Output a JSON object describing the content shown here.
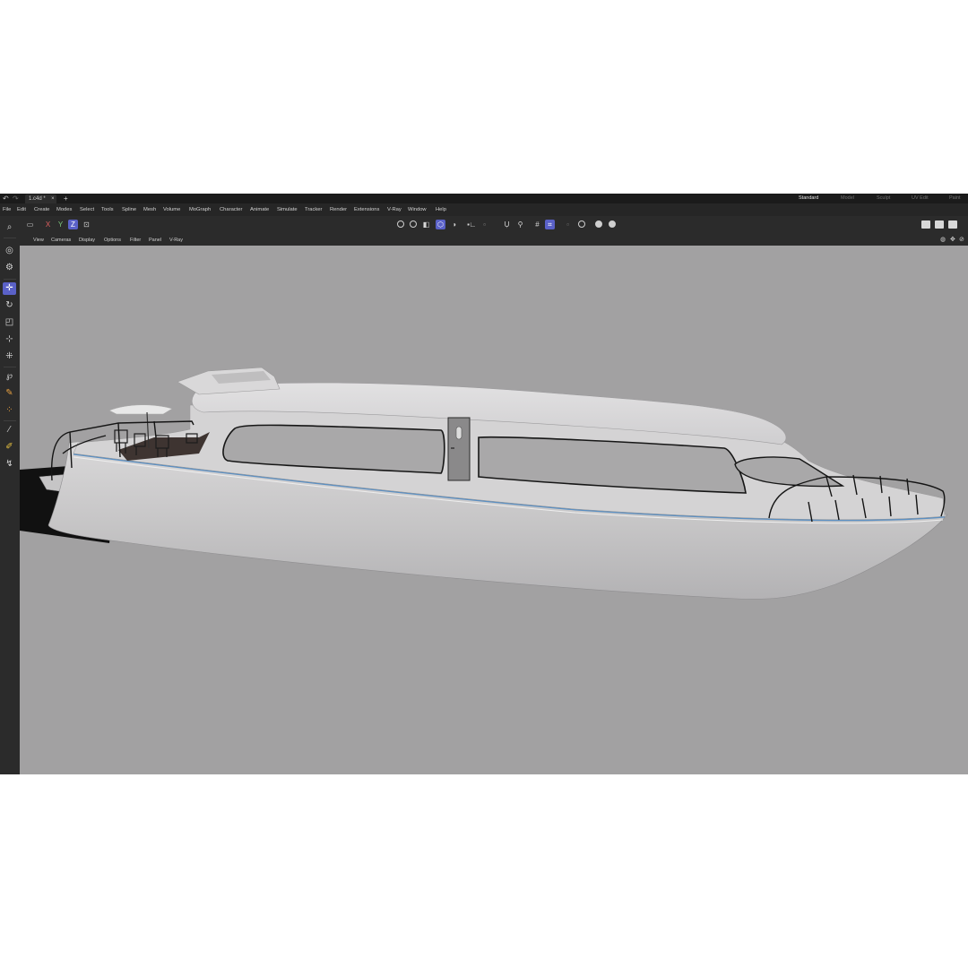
{
  "titlebar": {
    "undo_icon": "undo-arrow-icon",
    "redo_icon": "redo-arrow-icon",
    "document_tab": "1.c4d *",
    "close_glyph": "×",
    "new_tab_glyph": "+",
    "layouts": [
      {
        "label": "Standard",
        "active": true
      },
      {
        "label": "Model",
        "active": false
      },
      {
        "label": "Sculpt",
        "active": false
      },
      {
        "label": "UV Edit",
        "active": false
      },
      {
        "label": "Paint",
        "active": false
      }
    ]
  },
  "menu": [
    "File",
    "Edit",
    "Create",
    "Modes",
    "Select",
    "Tools",
    "Spline",
    "Mesh",
    "Volume",
    "MoGraph",
    "Character",
    "Animate",
    "Simulate",
    "Tracker",
    "Render",
    "Extensions",
    "V-Ray",
    "Window",
    "Help"
  ],
  "toolbar": {
    "axis_x": "X",
    "axis_y": "Y",
    "axis_z": "Z",
    "accent_color": "#5a61c7"
  },
  "viewport_menu": [
    "View",
    "Cameras",
    "Display",
    "Options",
    "Filter",
    "Panel",
    "V-Ray"
  ],
  "left_tools": [
    "search-icon",
    "live-selection-icon",
    "move-icon",
    "rotate-icon",
    "scale-icon",
    "axis-move-icon",
    "transform-icon",
    "spline-pen-icon",
    "paint-icon",
    "material-icon",
    "brush-icon",
    "sketch-icon",
    "knife-icon"
  ],
  "viewport": {
    "background": "#a2a1a2",
    "hull_stripe_color": "#5b8fc2"
  }
}
